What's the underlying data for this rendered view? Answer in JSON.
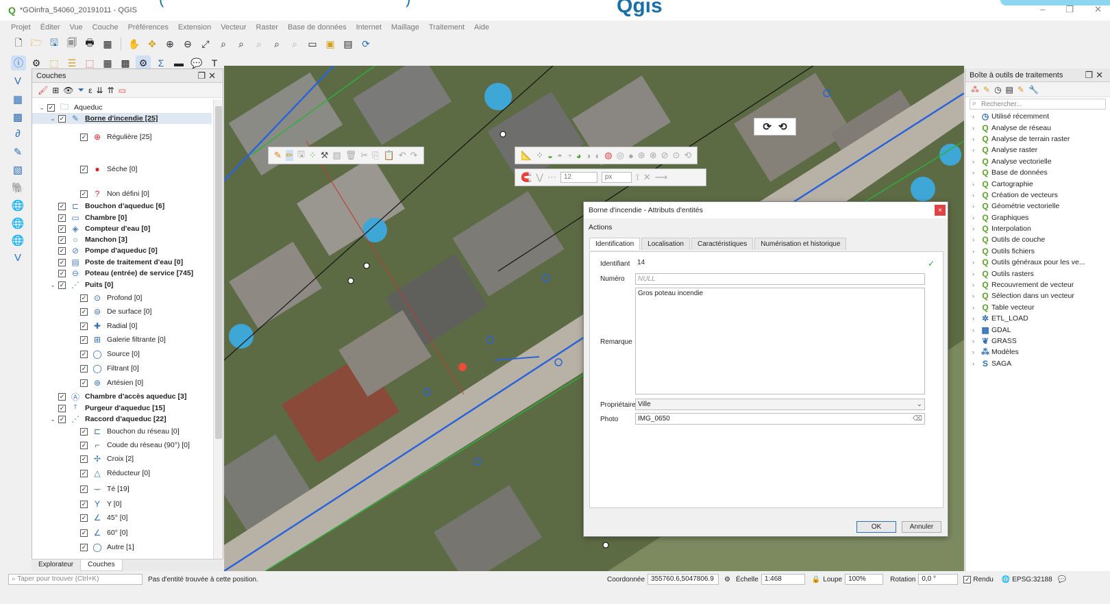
{
  "window": {
    "title": "*GOinfra_54060_20191011 - QGIS",
    "banner": "Qgis",
    "bracket_left": "(",
    "bracket_right": ")"
  },
  "menu": [
    "Projet",
    "Éditer",
    "Vue",
    "Couche",
    "Préférences",
    "Extension",
    "Vecteur",
    "Raster",
    "Base de données",
    "Internet",
    "Maillage",
    "Traitement",
    "Aide"
  ],
  "layers_panel": {
    "title": "Couches",
    "tree": [
      {
        "label": "Aqueduc",
        "level": 0,
        "expanded": true,
        "bold": false,
        "sym": "🗀"
      },
      {
        "label": "Borne d'incendie [25]",
        "level": 1,
        "expanded": true,
        "bold": true,
        "sym": "✎",
        "selected": true
      },
      {
        "label": "Régulière [25]",
        "level": 2,
        "sym": "⊕"
      },
      {
        "label": "Sèche [0]",
        "level": 2,
        "sym": "●"
      },
      {
        "label": "Non défini [0]",
        "level": 2,
        "sym": "?"
      },
      {
        "label": "Bouchon d'aqueduc [6]",
        "level": 1,
        "bold": true,
        "sym": "⊏"
      },
      {
        "label": "Chambre [0]",
        "level": 1,
        "bold": true,
        "sym": "▭"
      },
      {
        "label": "Compteur d'eau [0]",
        "level": 1,
        "bold": true,
        "sym": "◈"
      },
      {
        "label": "Manchon [3]",
        "level": 1,
        "bold": true,
        "sym": "○"
      },
      {
        "label": "Pompe d'aqueduc [0]",
        "level": 1,
        "bold": true,
        "sym": "⊘"
      },
      {
        "label": "Poste de traitement d'eau [0]",
        "level": 1,
        "bold": true,
        "sym": "▤"
      },
      {
        "label": "Poteau (entrée) de service [745]",
        "level": 1,
        "bold": true,
        "sym": "⊖"
      },
      {
        "label": "Puits [0]",
        "level": 1,
        "expanded": true,
        "bold": true,
        "sym": "⋰"
      },
      {
        "label": "Profond [0]",
        "level": 2,
        "sym": "⊙"
      },
      {
        "label": "De surface [0]",
        "level": 2,
        "sym": "⊜"
      },
      {
        "label": "Radial [0]",
        "level": 2,
        "sym": "✚"
      },
      {
        "label": "Galerie filtrante [0]",
        "level": 2,
        "sym": "⊞"
      },
      {
        "label": "Source [0]",
        "level": 2,
        "sym": "◯"
      },
      {
        "label": "Filtrant [0]",
        "level": 2,
        "sym": "◯"
      },
      {
        "label": "Artésien [0]",
        "level": 2,
        "sym": "⊚"
      },
      {
        "label": "Chambre d'accès aqueduc [3]",
        "level": 1,
        "bold": true,
        "sym": "Ⓐ"
      },
      {
        "label": "Purgeur d'aqueduc [15]",
        "level": 1,
        "bold": true,
        "sym": "ᵀ"
      },
      {
        "label": "Raccord d'aqueduc [22]",
        "level": 1,
        "expanded": true,
        "bold": true,
        "sym": "⋰"
      },
      {
        "label": "Bouchon du réseau [0]",
        "level": 2,
        "sym": "⊏"
      },
      {
        "label": "Coude du réseau (90°) [0]",
        "level": 2,
        "sym": "⌐"
      },
      {
        "label": "Croix [2]",
        "level": 2,
        "sym": "✢"
      },
      {
        "label": "Réducteur [0]",
        "level": 2,
        "sym": "△"
      },
      {
        "label": "Té [19]",
        "level": 2,
        "sym": "ᅮ"
      },
      {
        "label": "Y [0]",
        "level": 2,
        "sym": "Y"
      },
      {
        "label": "45° [0]",
        "level": 2,
        "sym": "∠"
      },
      {
        "label": "60° [0]",
        "level": 2,
        "sym": "∠"
      },
      {
        "label": "Autre [1]",
        "level": 2,
        "sym": "◯"
      }
    ],
    "tabs": [
      "Explorateur",
      "Couches"
    ]
  },
  "map": {
    "snap_value": "12",
    "snap_unit": "px"
  },
  "dialog": {
    "title": "Borne d'incendie - Attributs d'entités",
    "actions": "Actions",
    "tabs": [
      "Identification",
      "Localisation",
      "Caractéristiques",
      "Numérisation et historique"
    ],
    "fields": {
      "identifiant_label": "Identifiant",
      "identifiant": "14",
      "numero_label": "Numéro",
      "numero": "NULL",
      "remarque_label": "Remarque",
      "remarque": "Gros poteau incendie",
      "proprietaire_label": "Propriétaire",
      "proprietaire": "Ville",
      "photo_label": "Photo",
      "photo": "IMG_0650"
    },
    "ok": "OK",
    "cancel": "Annuler",
    "close": "×"
  },
  "toolbox": {
    "title": "Boîte à outils de traitements",
    "search_placeholder": "Rechercher...",
    "items": [
      {
        "label": "Utilisé récemment",
        "ic": "◷"
      },
      {
        "label": "Analyse de réseau",
        "ic": "Q"
      },
      {
        "label": "Analyse de terrain raster",
        "ic": "Q"
      },
      {
        "label": "Analyse raster",
        "ic": "Q"
      },
      {
        "label": "Analyse vectorielle",
        "ic": "Q"
      },
      {
        "label": "Base de données",
        "ic": "Q"
      },
      {
        "label": "Cartographie",
        "ic": "Q"
      },
      {
        "label": "Création de vecteurs",
        "ic": "Q"
      },
      {
        "label": "Géométrie vectorielle",
        "ic": "Q"
      },
      {
        "label": "Graphiques",
        "ic": "Q"
      },
      {
        "label": "Interpolation",
        "ic": "Q"
      },
      {
        "label": "Outils de couche",
        "ic": "Q"
      },
      {
        "label": "Outils fichiers",
        "ic": "Q"
      },
      {
        "label": "Outils généraux pour les ve...",
        "ic": "Q"
      },
      {
        "label": "Outils rasters",
        "ic": "Q"
      },
      {
        "label": "Recouvrement de vecteur",
        "ic": "Q"
      },
      {
        "label": "Sélection dans un vecteur",
        "ic": "Q"
      },
      {
        "label": "Table vecteur",
        "ic": "Q"
      },
      {
        "label": "ETL_LOAD",
        "ic": "✲"
      },
      {
        "label": "GDAL",
        "ic": "▦"
      },
      {
        "label": "GRASS",
        "ic": "❦"
      },
      {
        "label": "Modèles",
        "ic": "⁂"
      },
      {
        "label": "SAGA",
        "ic": "Ѕ"
      }
    ]
  },
  "status": {
    "locate_placeholder": "Taper pour trouver (Ctrl+K)",
    "message": "Pas d'entité trouvée à cette position.",
    "coord_label": "Coordonnée",
    "coord": "355760.6,5047806.9",
    "scale_label": "Échelle",
    "scale": "1:468",
    "zoom_label": "Loupe",
    "zoom": "100%",
    "rotation_label": "Rotation",
    "rotation": "0,0 °",
    "render_label": "Rendu",
    "crs": "EPSG:32188"
  }
}
